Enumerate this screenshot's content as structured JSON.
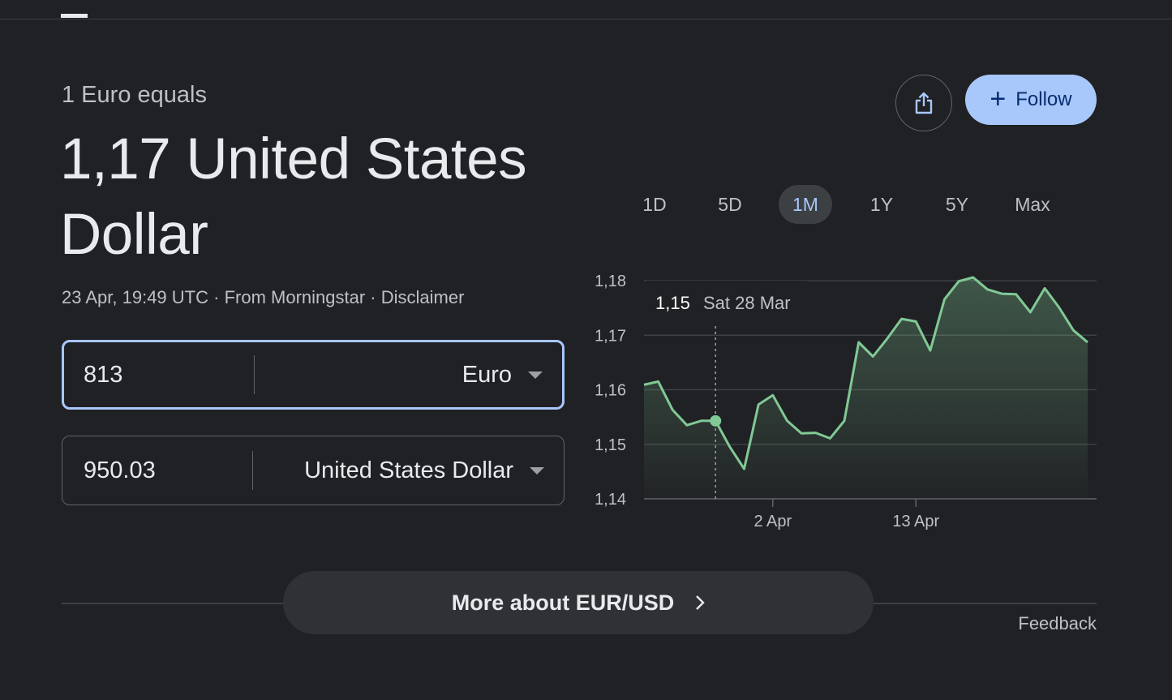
{
  "header": {
    "subhead": "1 Euro equals",
    "result_line": "1,17 United States Dollar"
  },
  "meta": {
    "timestamp": "23 Apr, 19:49 UTC",
    "sep1": " · ",
    "source": "From Morningstar",
    "sep2": " · ",
    "disclaimer": "Disclaimer"
  },
  "converter": {
    "from": {
      "amount": "813",
      "currency": "Euro"
    },
    "to": {
      "amount": "950.03",
      "currency": "United States Dollar"
    }
  },
  "actions": {
    "follow_label": "Follow",
    "plus": "+"
  },
  "ranges": [
    {
      "label": "1D",
      "selected": false
    },
    {
      "label": "5D",
      "selected": false
    },
    {
      "label": "1M",
      "selected": true
    },
    {
      "label": "1Y",
      "selected": false
    },
    {
      "label": "5Y",
      "selected": false
    },
    {
      "label": "Max",
      "selected": false
    }
  ],
  "tooltip": {
    "value": "1,15",
    "date": "Sat 28 Mar"
  },
  "chart_data": {
    "type": "area",
    "y_ticks": [
      "1,18",
      "1,17",
      "1,16",
      "1,15",
      "1,14"
    ],
    "y_tick_values": [
      1.18,
      1.17,
      1.16,
      1.15,
      1.14
    ],
    "ylim": [
      1.14,
      1.18
    ],
    "x_ticks": [
      {
        "label": "2 Apr",
        "index": 9
      },
      {
        "label": "13 Apr",
        "index": 19
      }
    ],
    "series": [
      {
        "values": [
          1.1609,
          1.1615,
          1.1563,
          1.1535,
          1.1543,
          1.1543,
          1.1495,
          1.1455,
          1.1573,
          1.159,
          1.1543,
          1.152,
          1.1521,
          1.1511,
          1.1543,
          1.1687,
          1.1661,
          1.1694,
          1.173,
          1.1725,
          1.1672,
          1.1766,
          1.1799,
          1.1806,
          1.1784,
          1.1776,
          1.1775,
          1.1742,
          1.1786,
          1.1751,
          1.1709,
          1.1687
        ]
      }
    ],
    "highlight_index": 5,
    "grid": true,
    "colors": {
      "line": "#81c995",
      "area": "#81c995",
      "grid": "#3c4043"
    }
  },
  "more": {
    "label": "More about EUR/USD"
  },
  "feedback": "Feedback"
}
